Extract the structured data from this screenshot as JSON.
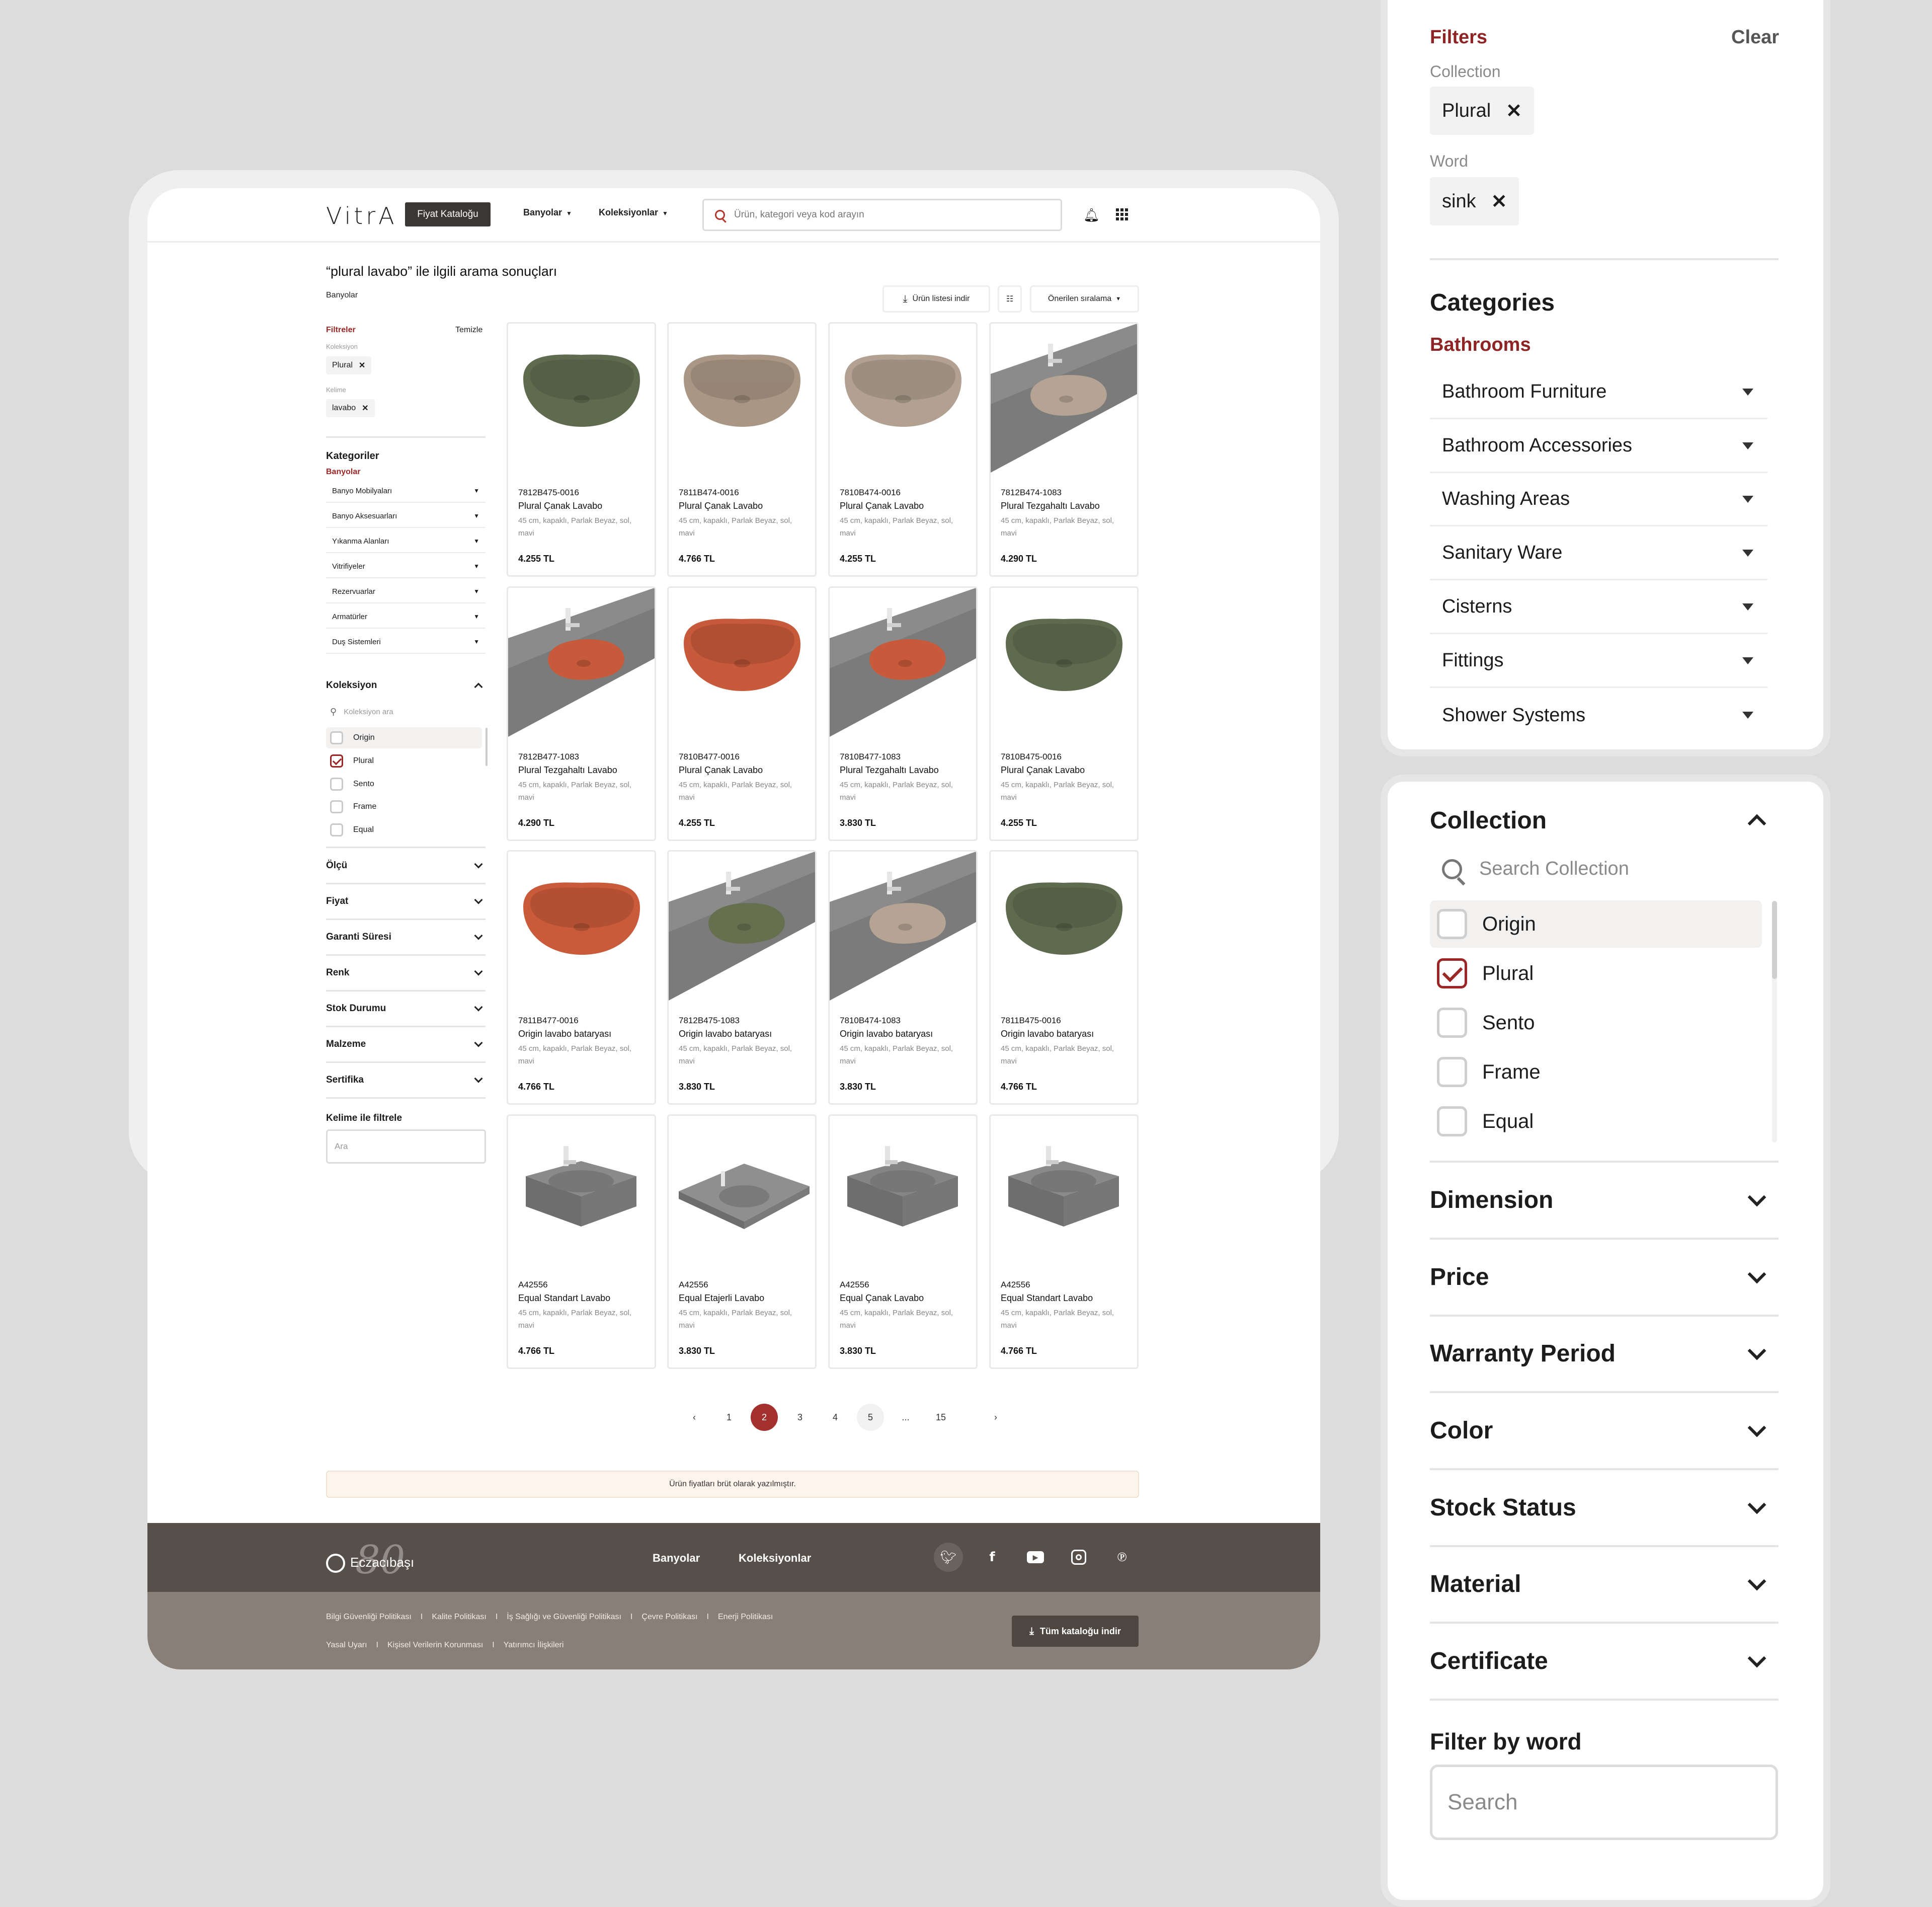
{
  "header": {
    "logo": "VitrA",
    "badge": "Fiyat Kataloğu",
    "nav": [
      "Banyolar",
      "Koleksiyonlar"
    ],
    "search_placeholder": "Ürün, kategori veya kod arayın"
  },
  "results": {
    "title": "“plural lavabo” ile ilgili arama sonuçları",
    "breadcrumb": "Banyolar",
    "download_label": "Ürün listesi indir",
    "sort_label": "Önerilen sıralama"
  },
  "sidebar": {
    "filters_title": "Filtreler",
    "clear_label": "Temizle",
    "collection_label": "Koleksiyon",
    "collection_chip": "Plural",
    "word_label": "Kelime",
    "word_chip": "lavabo",
    "categories_title": "Kategoriler",
    "active_category": "Banyolar",
    "categories": [
      "Banyo Mobilyaları",
      "Banyo Aksesuarları",
      "Yıkanma Alanları",
      "Vitrifiyeler",
      "Rezervuarlar",
      "Armatürler",
      "Duş Sistemleri"
    ],
    "collection_title": "Koleksiyon",
    "collection_search_placeholder": "Koleksiyon ara",
    "collections": [
      {
        "name": "Origin",
        "checked": false
      },
      {
        "name": "Plural",
        "checked": true
      },
      {
        "name": "Sento",
        "checked": false
      },
      {
        "name": "Frame",
        "checked": false
      },
      {
        "name": "Equal",
        "checked": false
      }
    ],
    "filter_groups": [
      "Ölçü",
      "Fiyat",
      "Garanti Süresi",
      "Renk",
      "Stok Durumu",
      "Malzeme",
      "Sertifika"
    ],
    "word_filter_title": "Kelime ile filtrele",
    "word_filter_placeholder": "Ara"
  },
  "products": [
    {
      "code": "7812B475-0016",
      "name": "Plural Çanak Lavabo",
      "desc": "45 cm, kapaklı, Parlak Beyaz, sol, mavi",
      "price": "4.255 TL",
      "img": "bowl",
      "color": "#5f6b4f"
    },
    {
      "code": "7811B474-0016",
      "name": "Plural Çanak Lavabo",
      "desc": "45 cm, kapaklı, Parlak Beyaz, sol, mavi",
      "price": "4.766 TL",
      "img": "bowl",
      "color": "#a99684"
    },
    {
      "code": "7810B474-0016",
      "name": "Plural Çanak Lavabo",
      "desc": "45 cm, kapaklı, Parlak Beyaz, sol, mavi",
      "price": "4.255 TL",
      "img": "bowl",
      "color": "#b2a190"
    },
    {
      "code": "7812B474-1083",
      "name": "Plural Tezgahaltı Lavabo",
      "desc": "45 cm, kapaklı, Parlak Beyaz, sol, mavi",
      "price": "4.290 TL",
      "img": "counter",
      "color": "#b5a393"
    },
    {
      "code": "7812B477-1083",
      "name": "Plural Tezgahaltı Lavabo",
      "desc": "45 cm, kapaklı, Parlak Beyaz, sol, mavi",
      "price": "4.290 TL",
      "img": "counter",
      "color": "#c65a3a"
    },
    {
      "code": "7810B477-0016",
      "name": "Plural Çanak Lavabo",
      "desc": "45 cm, kapaklı, Parlak Beyaz, sol, mavi",
      "price": "4.255 TL",
      "img": "bowl",
      "color": "#c75a3a"
    },
    {
      "code": "7810B477-1083",
      "name": "Plural Tezgahaltı Lavabo",
      "desc": "45 cm, kapaklı, Parlak Beyaz, sol, mavi",
      "price": "3.830 TL",
      "img": "counter",
      "color": "#c85a3b"
    },
    {
      "code": "7810B475-0016",
      "name": "Plural Çanak Lavabo",
      "desc": "45 cm, kapaklı, Parlak Beyaz, sol, mavi",
      "price": "4.255 TL",
      "img": "bowl",
      "color": "#5f6b4f"
    },
    {
      "code": "7811B477-0016",
      "name": "Origin lavabo bataryası",
      "desc": "45 cm, kapaklı, Parlak Beyaz, sol, mavi",
      "price": "4.766 TL",
      "img": "bowl",
      "color": "#c95b3b"
    },
    {
      "code": "7812B475-1083",
      "name": "Origin lavabo bataryası",
      "desc": "45 cm, kapaklı, Parlak Beyaz, sol, mavi",
      "price": "3.830 TL",
      "img": "counter",
      "color": "#66704f"
    },
    {
      "code": "7810B474-1083",
      "name": "Origin lavabo bataryası",
      "desc": "45 cm, kapaklı, Parlak Beyaz, sol, mavi",
      "price": "3.830 TL",
      "img": "counter",
      "color": "#b5a393"
    },
    {
      "code": "7811B475-0016",
      "name": "Origin lavabo bataryası",
      "desc": "45 cm, kapaklı, Parlak Beyaz, sol, mavi",
      "price": "4.766 TL",
      "img": "bowl",
      "color": "#5f6b4f"
    },
    {
      "code": "A42556",
      "name": "Equal Standart Lavabo",
      "desc": "45 cm, kapaklı, Parlak Beyaz, sol, mavi",
      "price": "4.766 TL",
      "img": "box",
      "color": "#8a8a8a"
    },
    {
      "code": "A42556",
      "name": "Equal Etajerli Lavabo",
      "desc": "45 cm, kapaklı, Parlak Beyaz, sol, mavi",
      "price": "3.830 TL",
      "img": "flat",
      "color": "#8f8f8f"
    },
    {
      "code": "A42556",
      "name": "Equal Çanak Lavabo",
      "desc": "45 cm, kapaklı, Parlak Beyaz, sol, mavi",
      "price": "3.830 TL",
      "img": "box",
      "color": "#858585"
    },
    {
      "code": "A42556",
      "name": "Equal Standart Lavabo",
      "desc": "45 cm, kapaklı, Parlak Beyaz, sol, mavi",
      "price": "4.766 TL",
      "img": "box",
      "color": "#8a8a8a"
    }
  ],
  "pagination": {
    "pages": [
      "1",
      "2",
      "3",
      "4",
      "5",
      "...",
      "15"
    ],
    "current": "2"
  },
  "notice": "Ürün fiyatları brüt olarak yazılmıştır.",
  "footer": {
    "brand": "Eczacıbaşı",
    "brand_watermark": "80",
    "links": [
      "Banyolar",
      "Koleksiyonlar"
    ],
    "social": [
      "twitter-icon",
      "facebook-icon",
      "youtube-icon",
      "instagram-icon",
      "pinterest-icon"
    ],
    "policy_row1": [
      "Bilgi Güvenliği Politikası",
      "Kalite Politikası",
      "İş Sağlığı ve Güvenliği Politikası",
      "Çevre Politikası",
      "Enerji Politikası"
    ],
    "policy_row2": [
      "Yasal Uyarı",
      "Kişisel Verilerin Korunması",
      "Yatırımcı İlişkileri"
    ],
    "catalog_button": "Tüm kataloğu indir"
  },
  "zoom_filters": {
    "title": "Filters",
    "clear": "Clear",
    "collection_label": "Collection",
    "collection_chip": "Plural",
    "word_label": "Word",
    "word_chip": "sink",
    "categories_title": "Categories",
    "active_category": "Bathrooms",
    "categories": [
      "Bathroom Furniture",
      "Bathroom Accessories",
      "Washing Areas",
      "Sanitary Ware",
      "Cisterns",
      "Fittings",
      "Shower Systems"
    ]
  },
  "zoom_collection": {
    "title": "Collection",
    "search_placeholder": "Search Collection",
    "items": [
      {
        "name": "Origin",
        "checked": false
      },
      {
        "name": "Plural",
        "checked": true
      },
      {
        "name": "Sento",
        "checked": false
      },
      {
        "name": "Frame",
        "checked": false
      },
      {
        "name": "Equal",
        "checked": false
      }
    ],
    "groups": [
      "Dimension",
      "Price",
      "Warranty Period",
      "Color",
      "Stock Status",
      "Material",
      "Certificate"
    ],
    "word_filter_title": "Filter by word",
    "word_filter_placeholder": "Search"
  },
  "colors": {
    "accent": "#9b2626",
    "footer_dark": "#574f49",
    "footer_light": "#8a7f77"
  }
}
